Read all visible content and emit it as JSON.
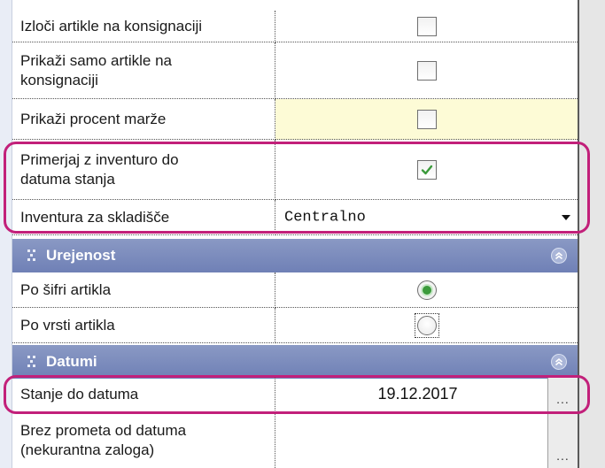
{
  "rows": {
    "r1": {
      "label": "Izloči artikle na konsignaciji",
      "checked": false
    },
    "r2": {
      "label": "Prikaži samo artikle na\nkonsignaciji",
      "checked": false
    },
    "r3": {
      "label": "Prikaži procent marže",
      "checked": false
    },
    "r4": {
      "label": "Primerjaj z inventuro do\ndatuma stanja",
      "checked": true
    },
    "r5": {
      "label": "Inventura za skladišče",
      "value": "Centralno"
    }
  },
  "section_urejenost": {
    "title": "Urejenost"
  },
  "sort": {
    "by_code": {
      "label": "Po šifri artikla",
      "selected": true
    },
    "by_type": {
      "label": "Po vrsti artikla",
      "selected": false
    }
  },
  "section_datumi": {
    "title": "Datumi"
  },
  "dates": {
    "stock_date": {
      "label": "Stanje do datuma",
      "value": "19.12.2017",
      "button": "..."
    },
    "no_turnover": {
      "label": "Brez prometa od datuma\n(nekurantna zaloga)",
      "value": "",
      "button": "..."
    }
  },
  "colors": {
    "highlight": "#c2207a",
    "section": "#7485ba",
    "yellow": "#fdfbd6",
    "check": "#3b9a3b"
  },
  "icons": {
    "grip": "grip-icon",
    "collapse": "collapse-chevron-icon",
    "dropdown": "dropdown-arrow-icon"
  }
}
